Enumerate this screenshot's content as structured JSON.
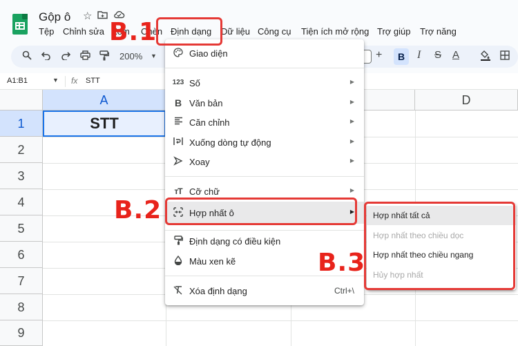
{
  "doc": {
    "title": "Gộp ô"
  },
  "menubar": [
    "Tệp",
    "Chỉnh sửa",
    "Xem",
    "Chèn",
    "Định dạng",
    "Dữ liệu",
    "Công cụ",
    "Tiện ích mở rộng",
    "Trợ giúp",
    "Trợ năng"
  ],
  "toolbar": {
    "zoom": "200%"
  },
  "formula": {
    "name_box": "A1:B1",
    "fx": "fx",
    "value": "STT"
  },
  "grid": {
    "columns": [
      "A",
      "D"
    ],
    "rows": [
      "1",
      "2",
      "3",
      "4",
      "5",
      "6",
      "7",
      "8",
      "9"
    ],
    "a1_value": "STT"
  },
  "format_menu": {
    "items": [
      {
        "icon": "palette-icon",
        "label": "Giao diện"
      },
      {
        "icon": "number-icon",
        "label": "Số"
      },
      {
        "icon": "bold-icon",
        "label": "Văn bản"
      },
      {
        "icon": "align-icon",
        "label": "Căn chỉnh"
      },
      {
        "icon": "wrap-icon",
        "label": "Xuống dòng tự động"
      },
      {
        "icon": "rotate-icon",
        "label": "Xoay"
      },
      {
        "icon": "font-size-icon",
        "label": "Cỡ chữ"
      },
      {
        "icon": "merge-icon",
        "label": "Hợp nhất ô"
      },
      {
        "icon": "paint-roller-icon",
        "label": "Định dạng có điều kiện"
      },
      {
        "icon": "droplet-icon",
        "label": "Màu xen kẽ"
      },
      {
        "icon": "clear-format-icon",
        "label": "Xóa định dạng",
        "shortcut": "Ctrl+\\"
      }
    ],
    "icons_text": {
      "number": "123"
    }
  },
  "merge_submenu": {
    "items": [
      {
        "label": "Hợp nhất tất cả",
        "enabled": true
      },
      {
        "label": "Hợp nhất theo chiều dọc",
        "enabled": false
      },
      {
        "label": "Hợp nhất theo chiều ngang",
        "enabled": true
      },
      {
        "label": "Hủy hợp nhất",
        "enabled": false
      }
    ]
  },
  "annotations": {
    "step1": "B.1",
    "step2": "B.2",
    "step3": "B.3"
  },
  "colors": {
    "annotation": "#e8231b",
    "selection": "#1a73e8",
    "sheets_green": "#1aa260"
  }
}
